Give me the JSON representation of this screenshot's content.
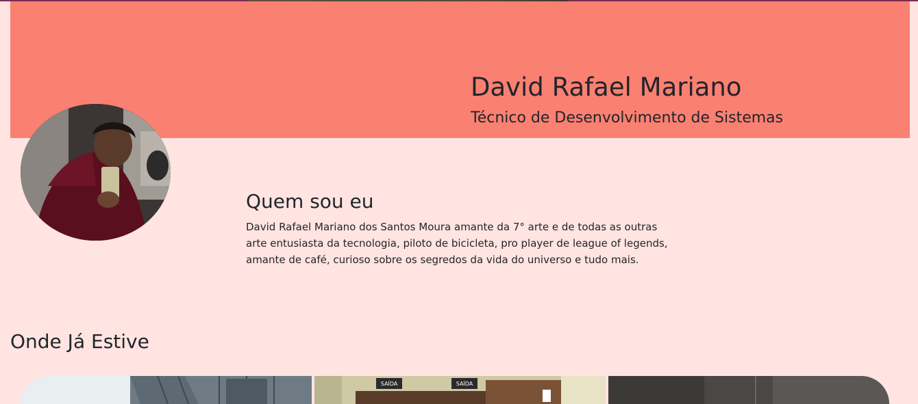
{
  "header": {
    "name": "David Rafael Mariano",
    "role": "Técnico de Desenvolvimento de Sistemas"
  },
  "about": {
    "title": "Quem sou eu",
    "text": "David Rafael Mariano dos Santos Moura amante da 7° arte e de todas as outras arte entusiasta da tecnologia, piloto de bicicleta, pro player de league of legends, amante de café, curioso sobre os segredos da vida do universo e tudo mais."
  },
  "places": {
    "title": "Onde Já Estive",
    "photos": [
      {
        "name": "place-photo-building"
      },
      {
        "name": "place-photo-exit-door",
        "signs": [
          "SAÍDA",
          "SAÍDA"
        ]
      },
      {
        "name": "place-photo-dark-room"
      }
    ]
  },
  "colors": {
    "background": "#ffe4e1",
    "banner": "#fa8072",
    "text": "#212529"
  }
}
